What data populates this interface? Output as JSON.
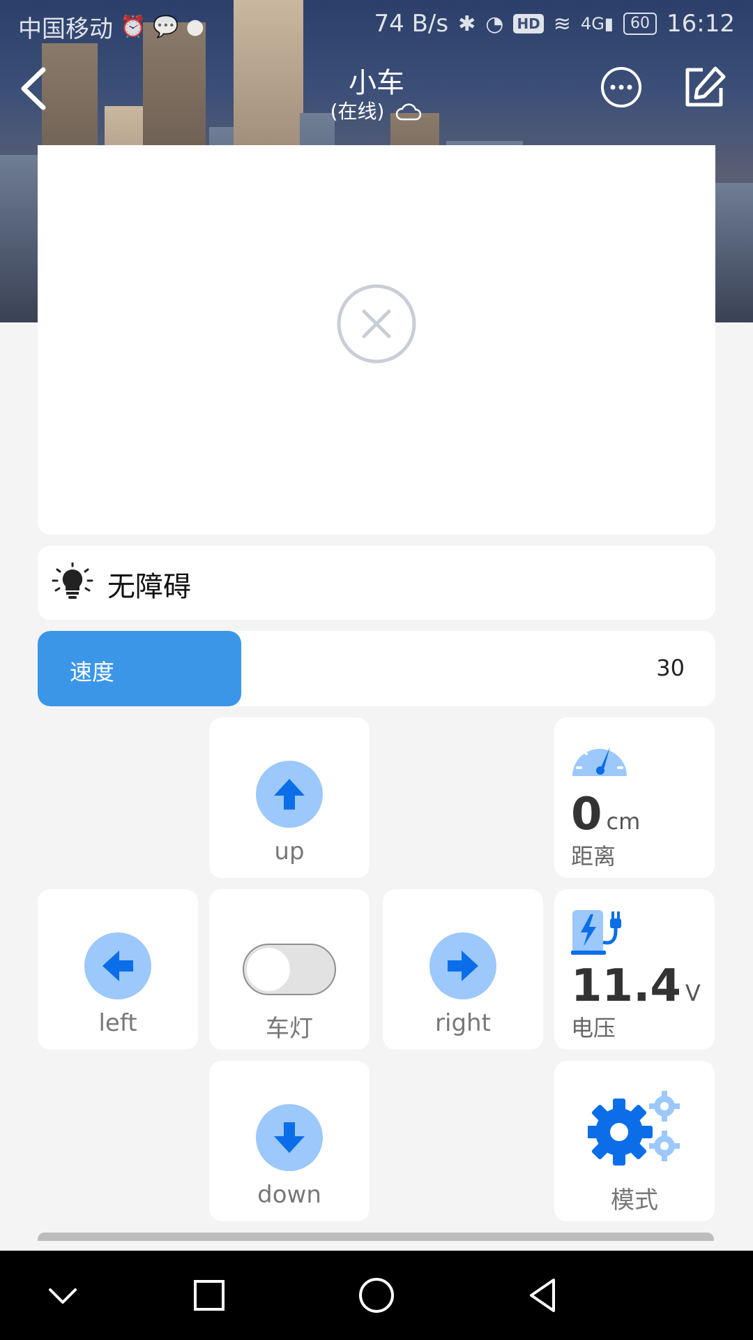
{
  "status_bar": {
    "carrier": "中国移动",
    "net_speed": "74 B/s",
    "battery": "60",
    "time": "16:12",
    "signal_type": "4G"
  },
  "nav": {
    "title": "小车",
    "subtitle": "(在线)"
  },
  "status": {
    "text": "无障碍"
  },
  "speed": {
    "label": "速度",
    "value": "30",
    "fill_fraction": 0.3
  },
  "controls": {
    "up": "up",
    "down": "down",
    "left": "left",
    "right": "right",
    "light": "车灯",
    "light_on": false
  },
  "distance": {
    "value": "0",
    "unit": "cm",
    "label": "距离"
  },
  "voltage": {
    "value": "11.4",
    "unit": "V",
    "label": "电压"
  },
  "mode": {
    "label": "模式"
  },
  "colors": {
    "accent": "#3b96e8",
    "icon_blue": "#1a73e8",
    "icon_light_blue": "#9cc8fb"
  },
  "icons": [
    "back-icon",
    "more-icon",
    "edit-icon",
    "cloud-icon",
    "error-icon",
    "bulb-icon",
    "arrow-up-icon",
    "arrow-down-icon",
    "arrow-left-icon",
    "arrow-right-icon",
    "gauge-icon",
    "charger-icon",
    "gears-icon"
  ]
}
